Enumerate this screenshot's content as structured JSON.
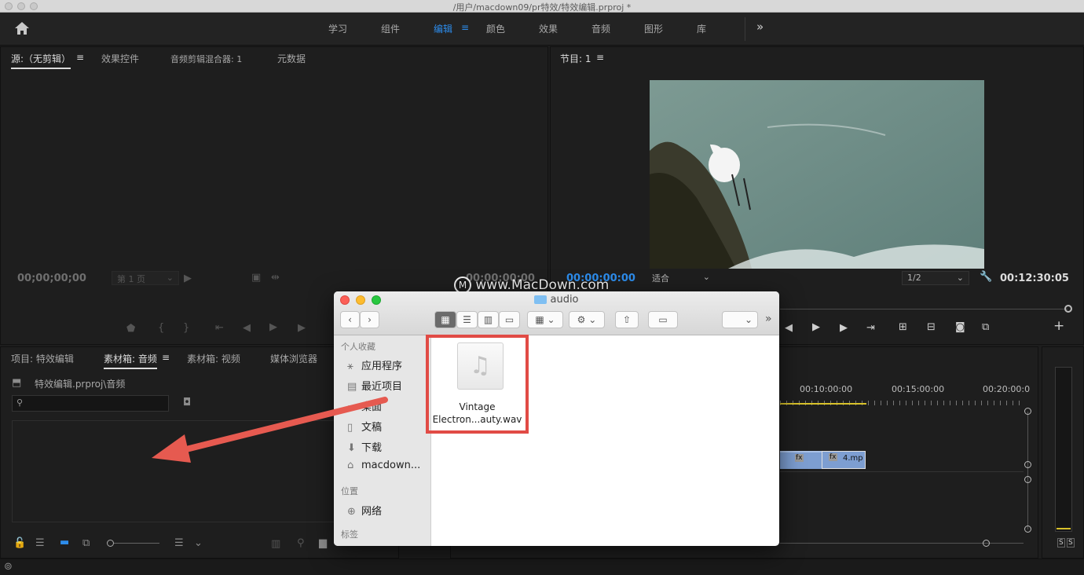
{
  "window": {
    "title": "/用户/macdown09/pr特效/特效编辑.prproj *"
  },
  "workspaces": {
    "home_icon": "home-icon",
    "tabs": [
      "学习",
      "组件",
      "编辑",
      "颜色",
      "效果",
      "音频",
      "图形",
      "库"
    ],
    "more": "»"
  },
  "source_panel": {
    "tabs": [
      "源:（无剪辑）",
      "效果控件",
      "音频剪辑混合器: 1",
      "元数据"
    ],
    "timecode_left": "00;00;00;00",
    "page_select": "第 1 页",
    "timecode_right": "00;00;00;00"
  },
  "program_panel": {
    "title": "节目: 1",
    "timecode": "00:00:00:00",
    "fit": "适合",
    "resolution": "1/2",
    "duration": "00:12:30:05"
  },
  "project_panel": {
    "tabs": [
      "项目: 特效编辑",
      "素材箱: 音频",
      "素材箱: 视频",
      "媒体浏览器"
    ],
    "path": "特效编辑.prproj\\音频",
    "search_placeholder": ""
  },
  "timeline": {
    "ruler": [
      "00:10:00:00",
      "00:15:00:00",
      "00:20:00:0"
    ],
    "clip_label": "4.mp",
    "meter_labels": [
      "S",
      "S"
    ]
  },
  "finder": {
    "title": "audio",
    "sidebar": {
      "favorites_header": "个人收藏",
      "favorites": [
        "应用程序",
        "最近项目",
        "桌面",
        "文稿",
        "下载",
        "macdown..."
      ],
      "locations_header": "位置",
      "locations": [
        "网络"
      ],
      "tags_header": "标签"
    },
    "file": {
      "line1": "Vintage",
      "line2": "Electron...auty.wav"
    }
  },
  "watermark": "www.MacDown.com",
  "colors": {
    "accent": "#2d8ceb",
    "highlight": "#e14b45",
    "arrow": "#e65a50"
  }
}
